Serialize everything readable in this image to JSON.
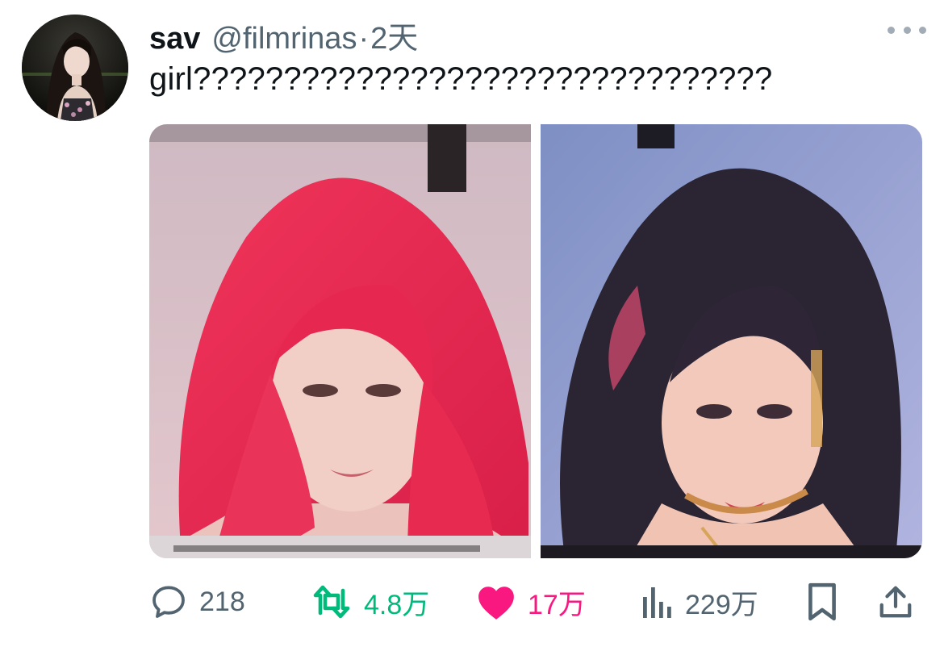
{
  "tweet": {
    "display_name": "sav",
    "handle": "@filmrinas",
    "separator": "·",
    "time": "2天",
    "text": "girl????????????????????????????????"
  },
  "actions": {
    "reply_count": "218",
    "retweet_count": "4.8万",
    "like_count": "17万",
    "views_count": "229万"
  },
  "icons": {
    "reply": "speech-bubble-icon",
    "retweet": "retweet-arrows-icon",
    "like": "heart-filled-icon",
    "views": "bar-chart-icon",
    "bookmark": "bookmark-icon",
    "share": "share-upload-icon",
    "more": "more-dots-icon"
  },
  "colors": {
    "text_primary": "#0f1419",
    "text_secondary": "#536471",
    "retweet_green": "#00ba7c",
    "like_pink": "#f91880"
  }
}
